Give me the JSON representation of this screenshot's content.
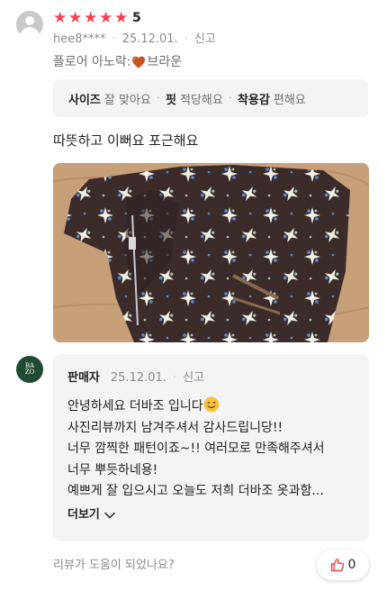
{
  "review": {
    "rating_value": "5",
    "star_count": 5,
    "star_color": "#fa3e4f",
    "username": "hee8****",
    "date": "25.12.01.",
    "report_label": "신고",
    "option_prefix": "플로어 아노락:",
    "option_color_icon": "heart-icon",
    "option_value": "브라운",
    "summary": [
      {
        "key": "사이즈",
        "value": "잘 맞아요"
      },
      {
        "key": "핏",
        "value": "적당해요"
      },
      {
        "key": "착용감",
        "value": "편해요"
      }
    ],
    "text": "따뜻하고 이뻐요 포근해요",
    "photo_subject": "brown floral fleece jacket"
  },
  "seller_reply": {
    "logo_text": [
      "BA",
      "ZO"
    ],
    "name": "판매자",
    "date": "25.12.01.",
    "report_label": "신고",
    "lines": [
      "안녕하세요 더바조 입니다",
      "사진리뷰까지 남겨주셔서 감사드립니당!!",
      "너무 깜찍한 패턴이죠~!! 여러모로 만족해주셔서",
      "너무 뿌듯하네용!",
      "예쁘게 잘 입으시고 오늘도 저희 더바조 옷과함..."
    ],
    "more_label": "더보기"
  },
  "footer": {
    "helpful_question": "리뷰가 도움이 되었나요?",
    "like_count": "0"
  },
  "colors": {
    "accent_red": "#fa3e4f",
    "box_bg": "#f4f4f5",
    "seller_green": "#1f4a33"
  }
}
